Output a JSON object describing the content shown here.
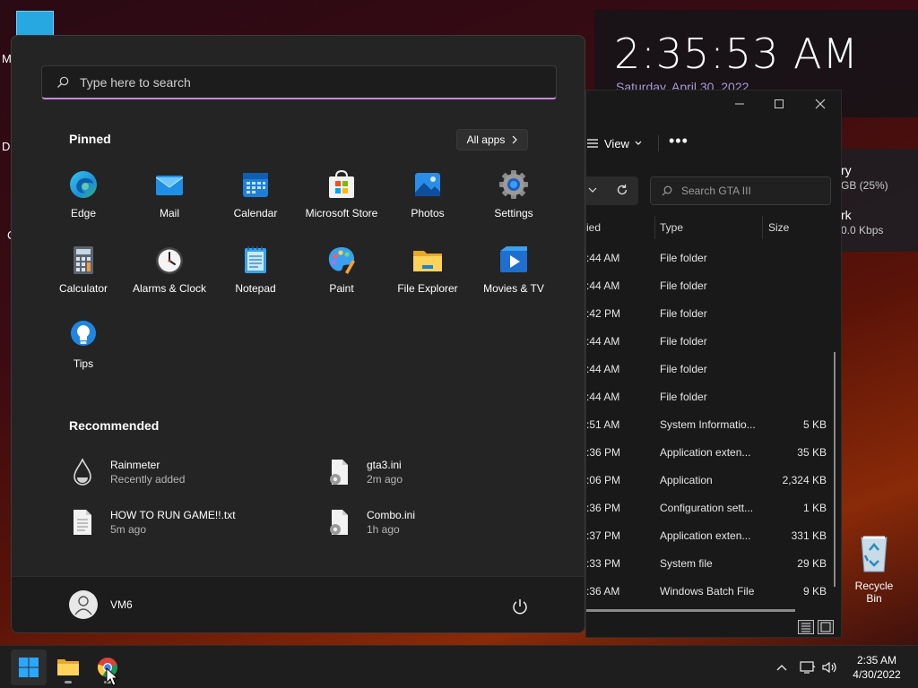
{
  "desktop": {
    "fragments": [
      "M",
      "Da",
      "C"
    ]
  },
  "rainmeter": {
    "time": "2:35:53 AM",
    "date": "Saturday, April 30, 2022",
    "memory_label": "ry",
    "memory_value": "GB (25%)",
    "network_label": "rk",
    "network_value": "0.0 Kbps"
  },
  "explorer": {
    "view_label": "View",
    "more_label": "•••",
    "search_placeholder": "Search GTA III",
    "columns": {
      "date": "ied",
      "type": "Type",
      "size": "Size"
    },
    "rows": [
      {
        "date": ":44 AM",
        "type": "File folder",
        "size": ""
      },
      {
        "date": ":44 AM",
        "type": "File folder",
        "size": ""
      },
      {
        "date": ":42 PM",
        "type": "File folder",
        "size": ""
      },
      {
        "date": ":44 AM",
        "type": "File folder",
        "size": ""
      },
      {
        "date": ":44 AM",
        "type": "File folder",
        "size": ""
      },
      {
        "date": ":44 AM",
        "type": "File folder",
        "size": ""
      },
      {
        "date": ":51 AM",
        "type": "System Informatio...",
        "size": "5 KB"
      },
      {
        "date": ":36 PM",
        "type": "Application exten...",
        "size": "35 KB"
      },
      {
        "date": ":06 PM",
        "type": "Application",
        "size": "2,324 KB"
      },
      {
        "date": ":36 PM",
        "type": "Configuration sett...",
        "size": "1 KB"
      },
      {
        "date": ":37 PM",
        "type": "Application exten...",
        "size": "331 KB"
      },
      {
        "date": ":33 PM",
        "type": "System file",
        "size": "29 KB"
      },
      {
        "date": ":36 AM",
        "type": "Windows Batch File",
        "size": "9 KB"
      }
    ]
  },
  "start_menu": {
    "search_placeholder": "Type here to search",
    "pinned_title": "Pinned",
    "all_apps_label": "All apps",
    "pinned": [
      {
        "label": "Edge",
        "icon": "edge-icon"
      },
      {
        "label": "Mail",
        "icon": "mail-icon"
      },
      {
        "label": "Calendar",
        "icon": "calendar-icon"
      },
      {
        "label": "Microsoft Store",
        "icon": "store-icon"
      },
      {
        "label": "Photos",
        "icon": "photos-icon"
      },
      {
        "label": "Settings",
        "icon": "gear-icon"
      },
      {
        "label": "Calculator",
        "icon": "calculator-icon"
      },
      {
        "label": "Alarms & Clock",
        "icon": "clock-icon"
      },
      {
        "label": "Notepad",
        "icon": "notepad-icon"
      },
      {
        "label": "Paint",
        "icon": "palette-icon"
      },
      {
        "label": "File Explorer",
        "icon": "folder-icon"
      },
      {
        "label": "Movies & TV",
        "icon": "play-icon"
      },
      {
        "label": "Tips",
        "icon": "lightbulb-icon"
      }
    ],
    "recommended_title": "Recommended",
    "recommended": [
      {
        "name": "Rainmeter",
        "sub": "Recently added",
        "icon": "droplet-icon"
      },
      {
        "name": "gta3.ini",
        "sub": "2m ago",
        "icon": "settings-file-icon"
      },
      {
        "name": "HOW TO RUN GAME!!.txt",
        "sub": "5m ago",
        "icon": "text-file-icon"
      },
      {
        "name": "Combo.ini",
        "sub": "1h ago",
        "icon": "settings-file-icon"
      }
    ],
    "user_name": "VM6"
  },
  "recycle_bin": {
    "label": "Recycle Bin"
  },
  "taskbar": {
    "clock_time": "2:35 AM",
    "clock_date": "4/30/2022"
  },
  "colors": {
    "accent": "#c38bd8",
    "start_bg": "#242424",
    "taskbar_bg": "#1e1e1e"
  }
}
